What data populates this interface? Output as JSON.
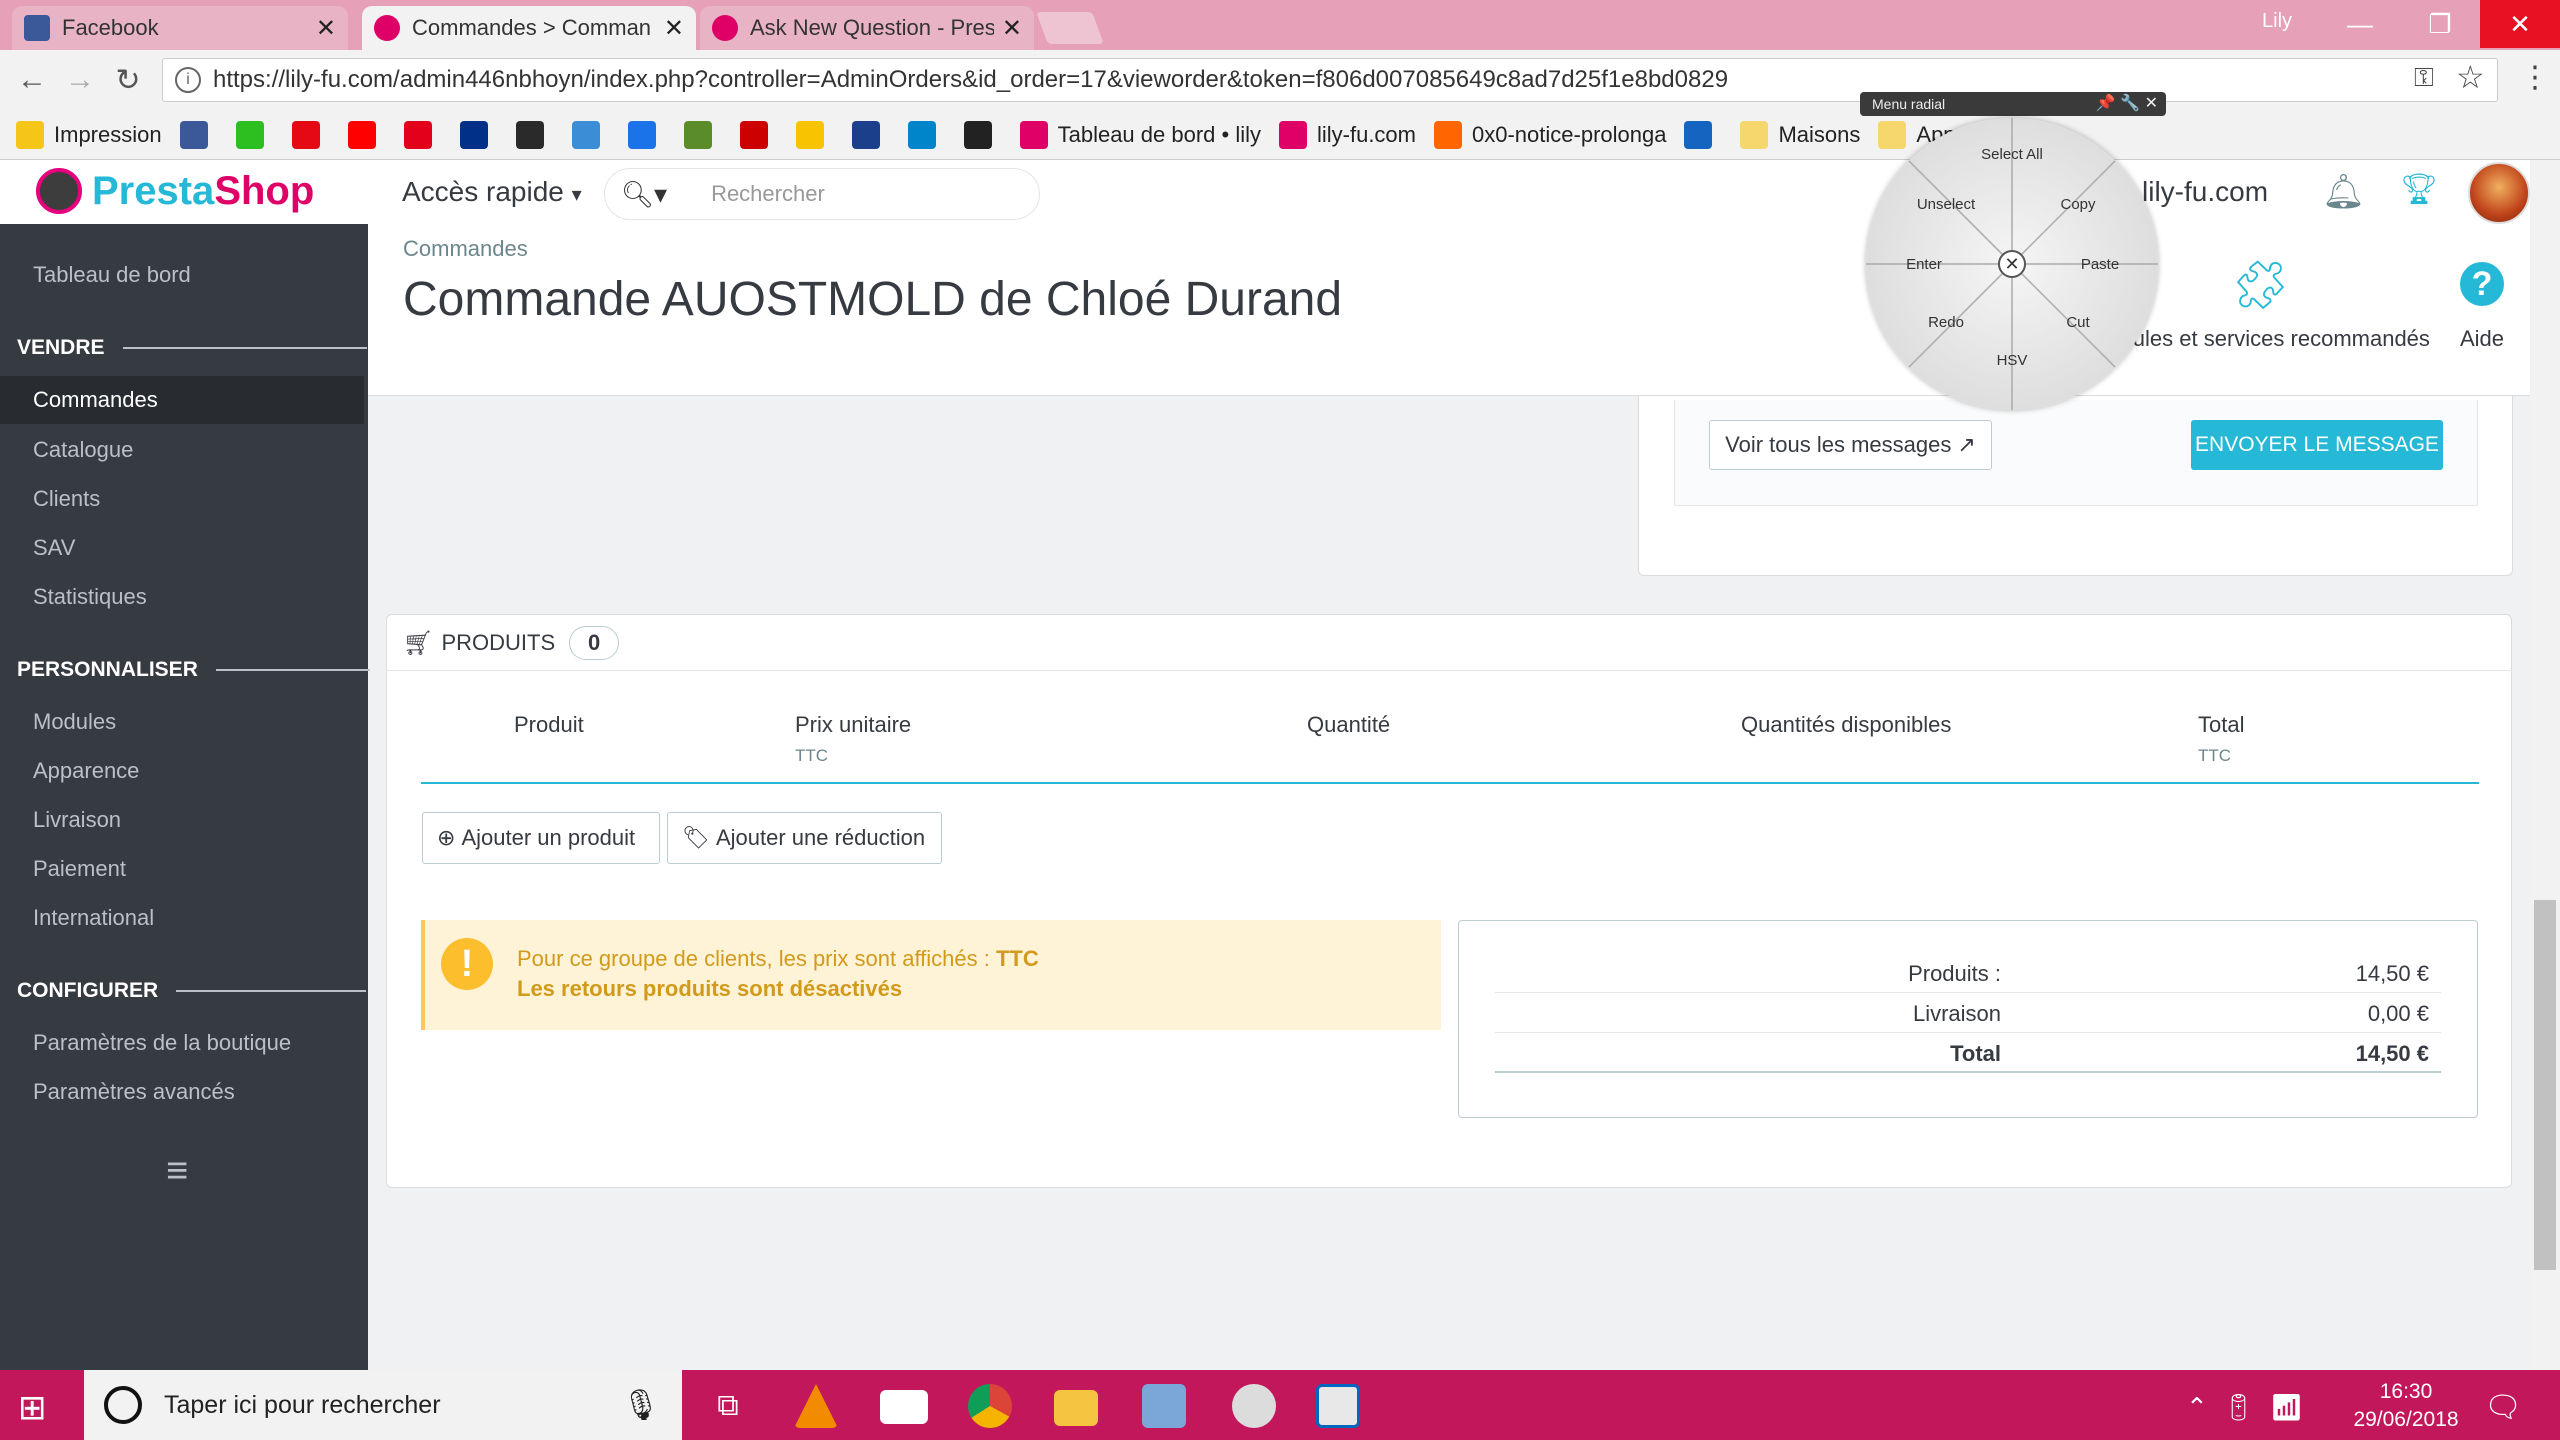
{
  "browser": {
    "tabs": [
      {
        "title": "Facebook",
        "color": "#3b5998"
      },
      {
        "title": "Commandes > Comman",
        "color": "#df0067"
      },
      {
        "title": "Ask New Question - Pres",
        "color": "#df0067"
      }
    ],
    "user": "Lily",
    "url": "https://lily-fu.com/admin446nbhoyn/index.php?controller=AdminOrders&id_order=17&vieworder&token=f806d007085649c8ad7d25f1e8bd0829",
    "bookmarks": [
      {
        "label": "Impression",
        "color": "#f5c518"
      },
      {
        "label": "",
        "color": "#3b5998"
      },
      {
        "label": "",
        "color": "#2dbf1f"
      },
      {
        "label": "",
        "color": "#e50914"
      },
      {
        "label": "",
        "color": "#ff0000"
      },
      {
        "label": "",
        "color": "#e2001a"
      },
      {
        "label": "",
        "color": "#003087"
      },
      {
        "label": "",
        "color": "#2a2a2a"
      },
      {
        "label": "",
        "color": "#3b8dd6"
      },
      {
        "label": "",
        "color": "#1a73e8"
      },
      {
        "label": "",
        "color": "#5b8c2a"
      },
      {
        "label": "",
        "color": "#cc0000"
      },
      {
        "label": "",
        "color": "#f8c300"
      },
      {
        "label": "",
        "color": "#1b3f8b"
      },
      {
        "label": "",
        "color": "#0085ca"
      },
      {
        "label": "",
        "color": "#222222"
      },
      {
        "label": "Tableau de bord • lily",
        "color": "#df0067"
      },
      {
        "label": "lily-fu.com",
        "color": "#df0067"
      },
      {
        "label": "0x0-notice-prolonga",
        "color": "#ff6600"
      },
      {
        "label": "",
        "color": "#1565c0"
      },
      {
        "label": "Maisons",
        "color": "#f5d76e"
      },
      {
        "label": "Appartements",
        "color": "#f5d76e"
      }
    ]
  },
  "header": {
    "logo_presta": "Presta",
    "logo_shop": "Shop",
    "quick_access": "Accès rapide",
    "search_placeholder": "Rechercher",
    "shop_name": "lily-fu.com"
  },
  "sidebar": {
    "dashboard": "Tableau de bord",
    "sections": [
      {
        "title": "VENDRE",
        "items": [
          "Commandes",
          "Catalogue",
          "Clients",
          "SAV",
          "Statistiques"
        ]
      },
      {
        "title": "PERSONNALISER",
        "items": [
          "Modules",
          "Apparence",
          "Livraison",
          "Paiement",
          "International"
        ]
      },
      {
        "title": "CONFIGURER",
        "items": [
          "Paramètres de la boutique",
          "Paramètres avancés"
        ]
      }
    ]
  },
  "page": {
    "breadcrumb": "Commandes",
    "title": "Commande AUOSTMOLD de Chloé Durand",
    "modules_label": "Modules et services recommandés",
    "help_label": "Aide"
  },
  "messages": {
    "view_all": "Voir tous les messages",
    "send": "ENVOYER LE MESSAGE"
  },
  "products": {
    "heading": "PRODUITS",
    "count": "0",
    "columns": [
      {
        "label": "Produit",
        "sub": ""
      },
      {
        "label": "Prix unitaire",
        "sub": "TTC"
      },
      {
        "label": "Quantité",
        "sub": ""
      },
      {
        "label": "Quantités disponibles",
        "sub": ""
      },
      {
        "label": "Total",
        "sub": "TTC"
      }
    ],
    "add_product": "Ajouter un produit",
    "add_discount": "Ajouter une réduction",
    "alert_line1": "Pour ce groupe de clients, les prix sont affichés : ",
    "alert_ttc": "TTC",
    "alert_line2": "Les retours produits sont désactivés",
    "totals": [
      {
        "label": "Produits :",
        "value": "14,50 €"
      },
      {
        "label": "Livraison",
        "value": "0,00 €"
      },
      {
        "label": "Total",
        "value": "14,50 €"
      }
    ]
  },
  "radial_menu": {
    "title": "Menu radial",
    "items": [
      "Select All",
      "Copy",
      "Paste",
      "Cut",
      "HSV",
      "Redo",
      "Enter",
      "Unselect"
    ]
  },
  "taskbar": {
    "search_placeholder": "Taper ici pour rechercher",
    "time": "16:30",
    "date": "29/06/2018"
  }
}
